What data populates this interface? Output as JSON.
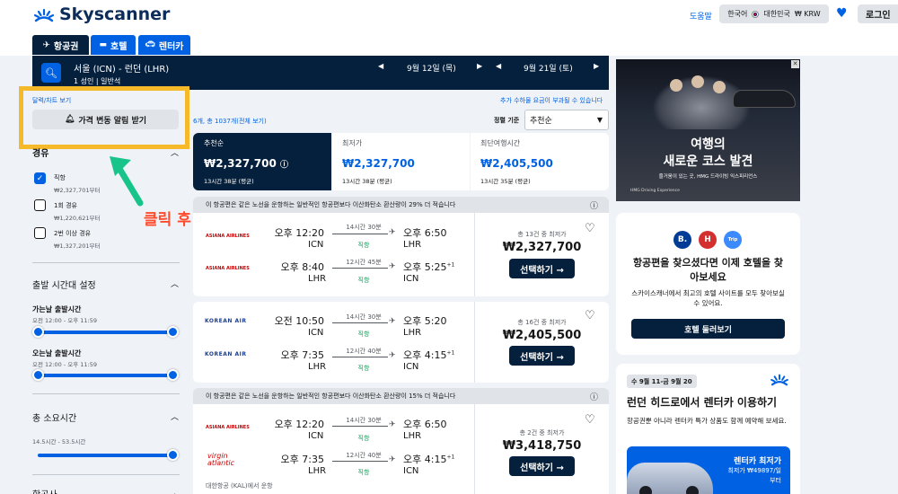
{
  "header": {
    "logo_text": "Skyscanner",
    "help": "도움말",
    "locale": "한국어",
    "country": "대한민국",
    "currency": "₩ KRW",
    "login": "로그인"
  },
  "tabs": [
    {
      "label": "항공권"
    },
    {
      "label": "호텔"
    },
    {
      "label": "렌터카"
    }
  ],
  "search": {
    "route": "서울 (ICN) - 런던 (LHR)",
    "pax": "1 성인",
    "cabin": "일반석",
    "depart_date": "9월 12일 (목)",
    "return_date": "9월 21일 (토)"
  },
  "sidebar": {
    "chart_link": "달력/차트 보기",
    "alert_button": "가격 변동 알림 받기",
    "stops_title": "경유",
    "stops": [
      {
        "label": "직항",
        "price": "₩2,327,701부터",
        "checked": true
      },
      {
        "label": "1회 경유",
        "price": "₩1,220,621부터",
        "checked": false
      },
      {
        "label": "2번 이상 경유",
        "price": "₩1,327,201부터",
        "checked": false
      }
    ],
    "time_title": "출발 시간대 설정",
    "outbound_title": "가는날 출발시간",
    "outbound_range": "오전 12:00 - 오후 11:59",
    "return_title": "오는날 출발시간",
    "return_range": "오전 12:00 - 오후 11:59",
    "duration_title": "총 소요시간",
    "duration_range": "14.5시간 - 53.5시간",
    "airlines_title": "항공사"
  },
  "annotation": {
    "text": "클릭 후 알림설정"
  },
  "results": {
    "extra_fees": "추가 수하물 요금이 부과될 수 있습니다",
    "count": "6개, 총 1037개(전체 보기)",
    "sort_label": "정렬 기준",
    "sort_value": "추천순",
    "sort_cards": [
      {
        "title": "추천순",
        "price": "₩2,327,700",
        "sub": "13시간 38분 (평균)"
      },
      {
        "title": "최저가",
        "price": "₩2,327,700",
        "sub": "13시간 38분 (평균)"
      },
      {
        "title": "최단여행시간",
        "price": "₩2,405,500",
        "sub": "13시간 35분 (평균)"
      }
    ],
    "notice1": "이 항공편은 같은 노선을 운항하는 일반적인 항공편보다 이산화탄소 환산량이 29% 더 적습니다",
    "notice2": "이 항공편은 같은 노선을 운항하는 일반적인 항공편보다 이산화탄소 환산량이 15% 더 적습니다",
    "select_label": "선택하기 →",
    "flights": [
      {
        "airline1": "ASIANA AIRLINES",
        "airline2": "ASIANA AIRLINES",
        "legs": [
          {
            "dep": "오후 12:20",
            "dep_code": "ICN",
            "dur": "14시간 30분",
            "stop": "직항",
            "arr": "오후 6:50",
            "arr_code": "LHR",
            "plus": ""
          },
          {
            "dep": "오후 8:40",
            "dep_code": "LHR",
            "dur": "12시간 45분",
            "stop": "직항",
            "arr": "오후 5:25",
            "arr_code": "ICN",
            "plus": "+1"
          }
        ],
        "deals": "총 13건 중 최저가",
        "price": "₩2,327,700"
      },
      {
        "airline1": "KOREAN AIR",
        "airline2": "KOREAN AIR",
        "legs": [
          {
            "dep": "오전 10:50",
            "dep_code": "ICN",
            "dur": "14시간 30분",
            "stop": "직항",
            "arr": "오후 5:20",
            "arr_code": "LHR",
            "plus": ""
          },
          {
            "dep": "오후 7:35",
            "dep_code": "LHR",
            "dur": "12시간 40분",
            "stop": "직항",
            "arr": "오후 4:15",
            "arr_code": "ICN",
            "plus": "+1"
          }
        ],
        "deals": "총 16건 중 최저가",
        "price": "₩2,405,500"
      },
      {
        "airline1": "ASIANA AIRLINES",
        "airline2": "virgin atlantic",
        "legs": [
          {
            "dep": "오후 12:20",
            "dep_code": "ICN",
            "dur": "14시간 30분",
            "stop": "직항",
            "arr": "오후 6:50",
            "arr_code": "LHR",
            "plus": ""
          },
          {
            "dep": "오후 7:35",
            "dep_code": "LHR",
            "dur": "12시간 40분",
            "stop": "직항",
            "arr": "오후 4:15",
            "arr_code": "ICN",
            "plus": "+1"
          }
        ],
        "operated_by": "대한항공 (KAL)에서 운항",
        "deals": "총 2건 중 최저가",
        "price": "₩3,418,750"
      }
    ]
  },
  "ad": {
    "headline1": "여행의",
    "headline2": "새로운 코스 발견",
    "tagline": "즐거움이 있는 곳, HMG 드라이빙 익스피리언스",
    "brand": "HMG Driving Experience"
  },
  "hotel_promo": {
    "title": "항공편을 찾으셨다면 이제 호텔을 찾아보세요",
    "body": "스카이스캐너에서 최고의 호텔 사이트를 모두 찾아보실 수 있어요.",
    "button": "호텔 둘러보기"
  },
  "car_promo": {
    "badge": "수 9월 11-금 9월 20",
    "title": "런던 히드로에서 렌터카 이용하기",
    "body": "항공권뿐 아니라 렌터카 특가 상품도 함께 예약해 보세요.",
    "card_title": "렌터카 최저가",
    "card_price": "최저가 ₩49897/일",
    "card_extra": "부터"
  }
}
